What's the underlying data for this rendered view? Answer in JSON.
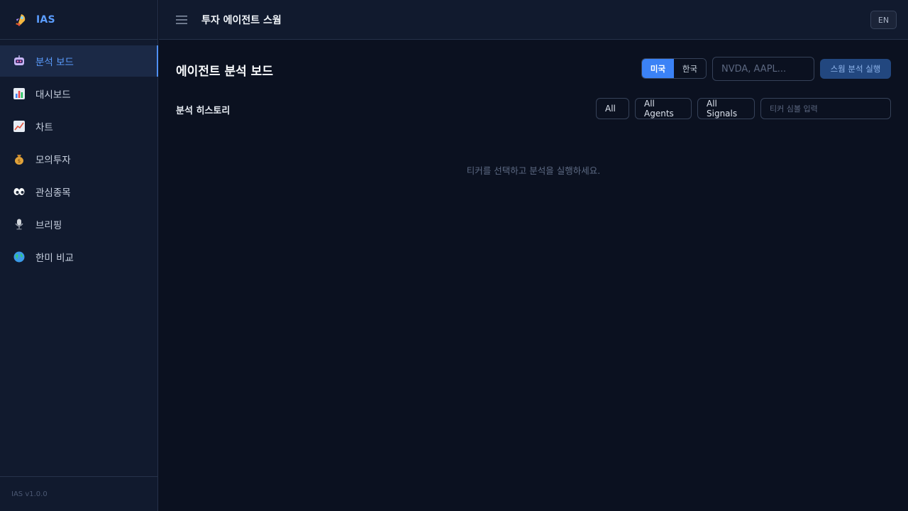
{
  "brand": {
    "name": "IAS",
    "logo_icon": "rocket-icon"
  },
  "sidebar": {
    "items": [
      {
        "label": "분석 보드",
        "icon": "robot-icon",
        "active": true
      },
      {
        "label": "대시보드",
        "icon": "bar-chart-icon",
        "active": false
      },
      {
        "label": "차트",
        "icon": "trend-chart-icon",
        "active": false
      },
      {
        "label": "모의투자",
        "icon": "money-bag-icon",
        "active": false
      },
      {
        "label": "관심종목",
        "icon": "eyes-icon",
        "active": false
      },
      {
        "label": "브리핑",
        "icon": "microphone-icon",
        "active": false
      },
      {
        "label": "한미 비교",
        "icon": "globe-icon",
        "active": false
      }
    ],
    "version": "IAS v1.0.0"
  },
  "header": {
    "title": "투자 에이전트 스웜",
    "lang_button": "EN"
  },
  "main": {
    "page_title": "에이전트 분석 보드",
    "market_toggle": {
      "us": "미국",
      "kr": "한국",
      "selected": "미국"
    },
    "ticker_input": {
      "placeholder": "NVDA, AAPL...",
      "value": ""
    },
    "run_button": "스웜 분석 실행",
    "history": {
      "title": "분석 히스토리",
      "filters": {
        "all": "All",
        "agents": "All Agents",
        "signals": "All Signals"
      },
      "symbol_input": {
        "placeholder": "티커 심볼 입력",
        "value": ""
      },
      "empty_message": "티커를 선택하고 분석을 실행하세요."
    }
  },
  "colors": {
    "background": "#0b1120",
    "panel": "#111a2e",
    "accent": "#3b82f6",
    "active_text": "#5b9dff",
    "border": "#26324a"
  }
}
